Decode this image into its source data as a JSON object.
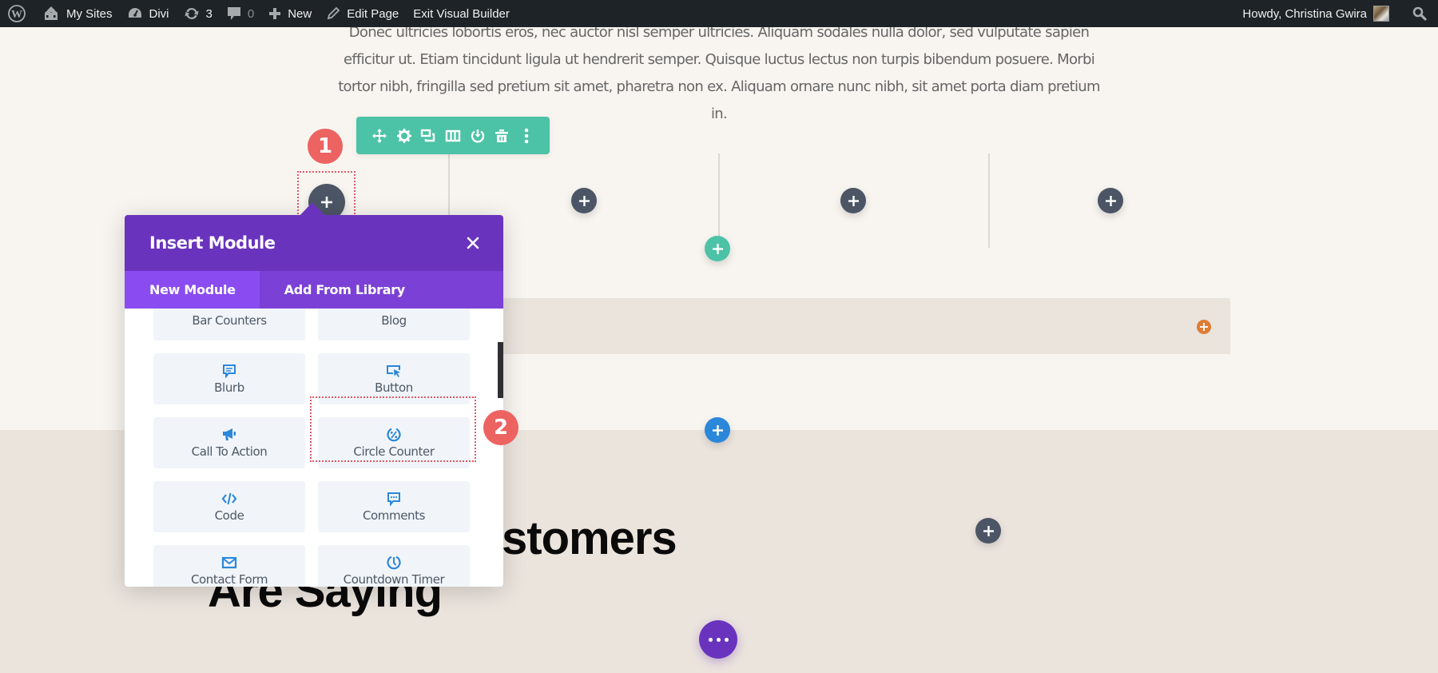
{
  "adminbar": {
    "items": [
      {
        "name": "wordpress-logo",
        "label": ""
      },
      {
        "name": "my-sites",
        "label": "My Sites"
      },
      {
        "name": "divi",
        "label": "Divi"
      },
      {
        "name": "updates",
        "label": "3"
      },
      {
        "name": "comments",
        "label": "0"
      },
      {
        "name": "new",
        "label": "New"
      },
      {
        "name": "edit-page",
        "label": "Edit Page"
      },
      {
        "name": "exit-visual-builder",
        "label": "Exit Visual Builder"
      }
    ],
    "greeting": "Howdy, Christina Gwira"
  },
  "content": {
    "paragraph": "Donec ultricies lobortis eros, nec auctor nisl semper ultricies. Aliquam sodales nulla dolor, sed vulputate sapien efficitur ut. Etiam tincidunt ligula ut hendrerit semper. Quisque luctus lectus non turpis bibendum posuere. Morbi tortor nibh, fringilla sed pretium sit amet, pharetra non ex. Aliquam ornare nunc nibh, sit amet porta diam pretium in.",
    "heading_line1_visible": "stomers",
    "heading_line2": "Are Saying"
  },
  "annotations": {
    "step1": "1",
    "step2": "2"
  },
  "row_toolbar": {
    "icons": [
      "move-icon",
      "settings-icon",
      "duplicate-icon",
      "columns-icon",
      "save-to-library-icon",
      "delete-icon",
      "more-options-icon"
    ]
  },
  "modal": {
    "title": "Insert Module",
    "tabs": [
      {
        "label": "New Module",
        "active": true
      },
      {
        "label": "Add From Library",
        "active": false
      }
    ],
    "modules": [
      {
        "label": "Bar Counters",
        "icon": "bar-counters-icon"
      },
      {
        "label": "Blog",
        "icon": "blog-icon"
      },
      {
        "label": "Blurb",
        "icon": "blurb-icon"
      },
      {
        "label": "Button",
        "icon": "button-icon"
      },
      {
        "label": "Call To Action",
        "icon": "call-to-action-icon"
      },
      {
        "label": "Circle Counter",
        "icon": "circle-counter-icon"
      },
      {
        "label": "Code",
        "icon": "code-icon"
      },
      {
        "label": "Comments",
        "icon": "comments-icon"
      },
      {
        "label": "Contact Form",
        "icon": "contact-form-icon"
      },
      {
        "label": "Countdown Timer",
        "icon": "countdown-timer-icon"
      }
    ]
  },
  "colors": {
    "divi_purple": "#6a33bd",
    "tab_active": "#8a4cf0",
    "row_teal": "#4cc2a6",
    "section_blue": "#2b87da",
    "module_dark": "#4b5565",
    "annotation_red": "#ec6361",
    "module_icon_blue": "#2b87da"
  }
}
